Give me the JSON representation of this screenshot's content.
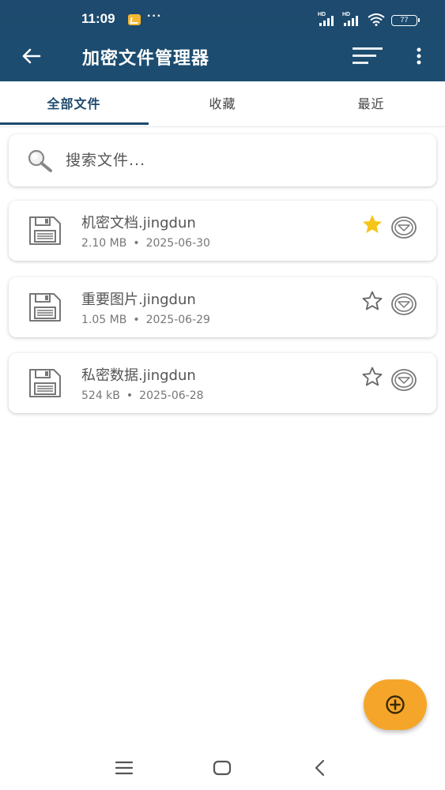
{
  "status_bar": {
    "time": "11:09",
    "more": "···",
    "signal_label_1": "HD",
    "signal_label_2": "HD",
    "battery": "77"
  },
  "app_bar": {
    "title": "加密文件管理器",
    "back_icon": "arrow-left-icon",
    "sort_icon": "sort-icon",
    "menu_icon": "more-vertical-icon"
  },
  "tabs": [
    {
      "label": "全部文件",
      "active": true
    },
    {
      "label": "收藏",
      "active": false
    },
    {
      "label": "最近",
      "active": false
    }
  ],
  "search": {
    "placeholder": "搜索文件..."
  },
  "files": [
    {
      "name": "机密文档.jingdun",
      "size": "2.10 MB",
      "separator": "•",
      "date": "2025-06-30",
      "favorite": true
    },
    {
      "name": "重要图片.jingdun",
      "size": "1.05 MB",
      "separator": "•",
      "date": "2025-06-29",
      "favorite": false
    },
    {
      "name": "私密数据.jingdun",
      "size": "524 kB",
      "separator": "•",
      "date": "2025-06-28",
      "favorite": false
    }
  ],
  "colors": {
    "primary": "#1d4a6e",
    "accent": "#f5a62a",
    "star_filled": "#f5c518"
  }
}
